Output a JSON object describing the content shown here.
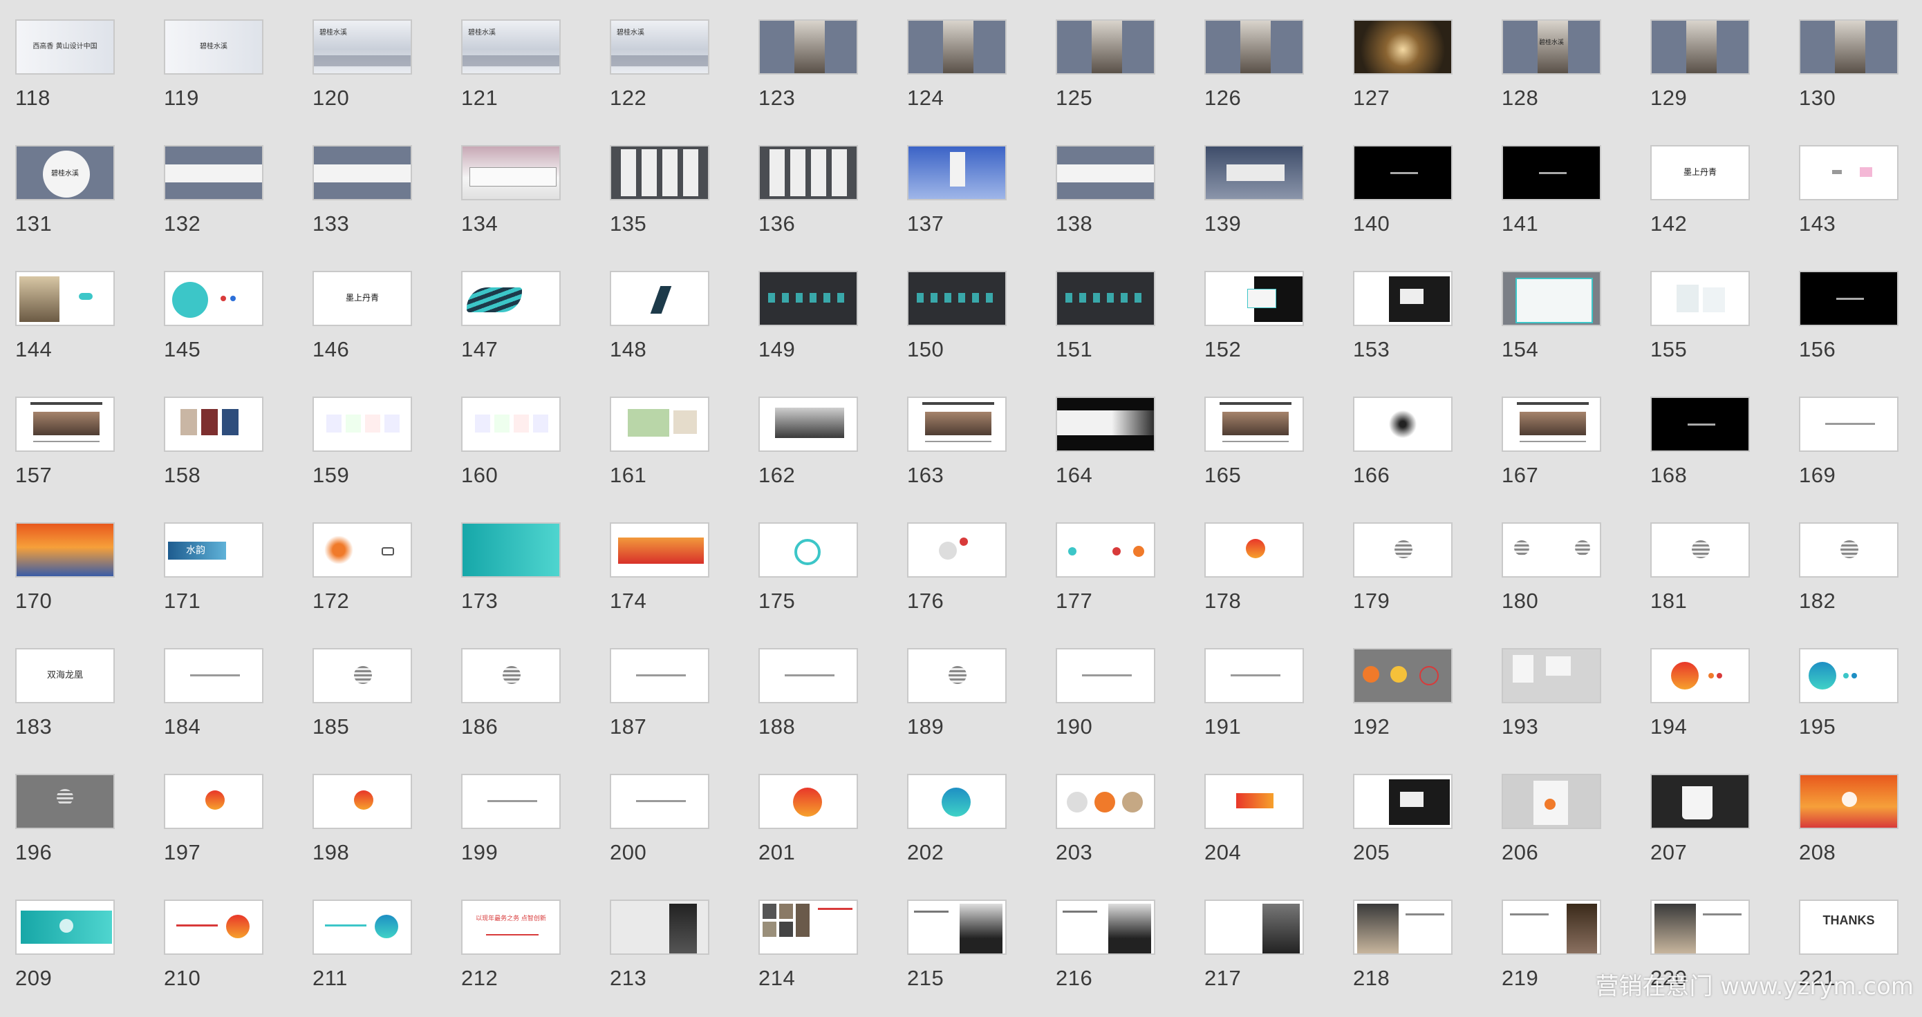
{
  "colors": {
    "background": "#e2e2e2",
    "slate": "#6f7a90",
    "dark": "#2f3236",
    "teal": "#3cc6c8",
    "orange": "#f07a2a",
    "red": "#d83a3a"
  },
  "slides": [
    {
      "n": "118",
      "k": "white-ink",
      "t": "西高香 黄山设计中国"
    },
    {
      "n": "119",
      "k": "white-ink",
      "t": "碧桂水溪"
    },
    {
      "n": "120",
      "k": "ink-wash",
      "t": "碧桂水溪"
    },
    {
      "n": "121",
      "k": "ink-wash",
      "t": "碧桂水溪"
    },
    {
      "n": "122",
      "k": "ink-wash",
      "t": "碧桂水溪"
    },
    {
      "n": "123",
      "k": "slate-photo"
    },
    {
      "n": "124",
      "k": "slate-photo"
    },
    {
      "n": "125",
      "k": "slate-photo"
    },
    {
      "n": "126",
      "k": "slate-photo"
    },
    {
      "n": "127",
      "k": "corridor"
    },
    {
      "n": "128",
      "k": "slate-photo",
      "t": "碧桂水溪"
    },
    {
      "n": "129",
      "k": "slate-photo"
    },
    {
      "n": "130",
      "k": "slate-photo"
    },
    {
      "n": "131",
      "k": "moon"
    },
    {
      "n": "132",
      "k": "slate-band"
    },
    {
      "n": "133",
      "k": "slate-band"
    },
    {
      "n": "134",
      "k": "billboard"
    },
    {
      "n": "135",
      "k": "dark-panels"
    },
    {
      "n": "136",
      "k": "dark-panels"
    },
    {
      "n": "137",
      "k": "sky-flag"
    },
    {
      "n": "138",
      "k": "slate-band"
    },
    {
      "n": "139",
      "k": "station"
    },
    {
      "n": "140",
      "k": "black"
    },
    {
      "n": "141",
      "k": "black"
    },
    {
      "n": "142",
      "k": "white",
      "t": "墨上丹青"
    },
    {
      "n": "143",
      "k": "white-pink"
    },
    {
      "n": "144",
      "k": "bird"
    },
    {
      "n": "145",
      "k": "teal-circle"
    },
    {
      "n": "146",
      "k": "white",
      "t": "墨上丹青"
    },
    {
      "n": "147",
      "k": "wave"
    },
    {
      "n": "148",
      "k": "white-shape"
    },
    {
      "n": "149",
      "k": "dark-teal"
    },
    {
      "n": "150",
      "k": "dark-teal"
    },
    {
      "n": "151",
      "k": "dark-teal"
    },
    {
      "n": "152",
      "k": "card"
    },
    {
      "n": "153",
      "k": "card-dark"
    },
    {
      "n": "154",
      "k": "teal-frame"
    },
    {
      "n": "155",
      "k": "white-boxes"
    },
    {
      "n": "156",
      "k": "black"
    },
    {
      "n": "157",
      "k": "doc-photo"
    },
    {
      "n": "158",
      "k": "doc-books"
    },
    {
      "n": "159",
      "k": "doc-cols"
    },
    {
      "n": "160",
      "k": "doc-cols"
    },
    {
      "n": "161",
      "k": "doc-map"
    },
    {
      "n": "162",
      "k": "doc-bw"
    },
    {
      "n": "163",
      "k": "doc-photo"
    },
    {
      "n": "164",
      "k": "banner-dark"
    },
    {
      "n": "165",
      "k": "doc-photo"
    },
    {
      "n": "166",
      "k": "doc-ink"
    },
    {
      "n": "167",
      "k": "doc-photo"
    },
    {
      "n": "168",
      "k": "black"
    },
    {
      "n": "169",
      "k": "white-line"
    },
    {
      "n": "170",
      "k": "sunset"
    },
    {
      "n": "171",
      "k": "water",
      "t": "水韵"
    },
    {
      "n": "172",
      "k": "orange-brush"
    },
    {
      "n": "173",
      "k": "teal-full"
    },
    {
      "n": "174",
      "k": "sunset-strip"
    },
    {
      "n": "175",
      "k": "logo-teal"
    },
    {
      "n": "176",
      "k": "logo-red"
    },
    {
      "n": "177",
      "k": "logo-row"
    },
    {
      "n": "178",
      "k": "logo-ball"
    },
    {
      "n": "179",
      "k": "logo-gray"
    },
    {
      "n": "180",
      "k": "logo-gray2"
    },
    {
      "n": "181",
      "k": "logo-gray"
    },
    {
      "n": "182",
      "k": "logo-gray"
    },
    {
      "n": "183",
      "k": "brand-text",
      "t": "双海龙凰"
    },
    {
      "n": "184",
      "k": "white-line"
    },
    {
      "n": "185",
      "k": "logo-gray"
    },
    {
      "n": "186",
      "k": "logo-gray"
    },
    {
      "n": "187",
      "k": "white-line"
    },
    {
      "n": "188",
      "k": "white-line"
    },
    {
      "n": "189",
      "k": "logo-gray"
    },
    {
      "n": "190",
      "k": "white-line"
    },
    {
      "n": "191",
      "k": "white-line"
    },
    {
      "n": "192",
      "k": "gray-balls"
    },
    {
      "n": "193",
      "k": "stationery"
    },
    {
      "n": "194",
      "k": "orange-ball"
    },
    {
      "n": "195",
      "k": "teal-ball"
    },
    {
      "n": "196",
      "k": "gray-logo"
    },
    {
      "n": "197",
      "k": "logo-ball"
    },
    {
      "n": "198",
      "k": "logo-ball"
    },
    {
      "n": "199",
      "k": "white-line"
    },
    {
      "n": "200",
      "k": "white-line"
    },
    {
      "n": "201",
      "k": "orange-ball-c"
    },
    {
      "n": "202",
      "k": "teal-ball-c"
    },
    {
      "n": "203",
      "k": "three-balls"
    },
    {
      "n": "204",
      "k": "red-rect"
    },
    {
      "n": "205",
      "k": "card-dark"
    },
    {
      "n": "206",
      "k": "bag"
    },
    {
      "n": "207",
      "k": "mug"
    },
    {
      "n": "208",
      "k": "sunset-logo"
    },
    {
      "n": "209",
      "k": "teal-logo"
    },
    {
      "n": "210",
      "k": "orange-ball-r"
    },
    {
      "n": "211",
      "k": "teal-ball-r"
    },
    {
      "n": "212",
      "k": "red-text",
      "t": "以现年最务之务 点智创新"
    },
    {
      "n": "213",
      "k": "profile"
    },
    {
      "n": "214",
      "k": "collage"
    },
    {
      "n": "215",
      "k": "profile2"
    },
    {
      "n": "216",
      "k": "profile2"
    },
    {
      "n": "217",
      "k": "profile3"
    },
    {
      "n": "218",
      "k": "profile4"
    },
    {
      "n": "219",
      "k": "profile5"
    },
    {
      "n": "220",
      "k": "profile4"
    },
    {
      "n": "221",
      "k": "thanks",
      "t": "THANKS"
    }
  ],
  "watermark": "营销在意门 www.yzrym.com"
}
